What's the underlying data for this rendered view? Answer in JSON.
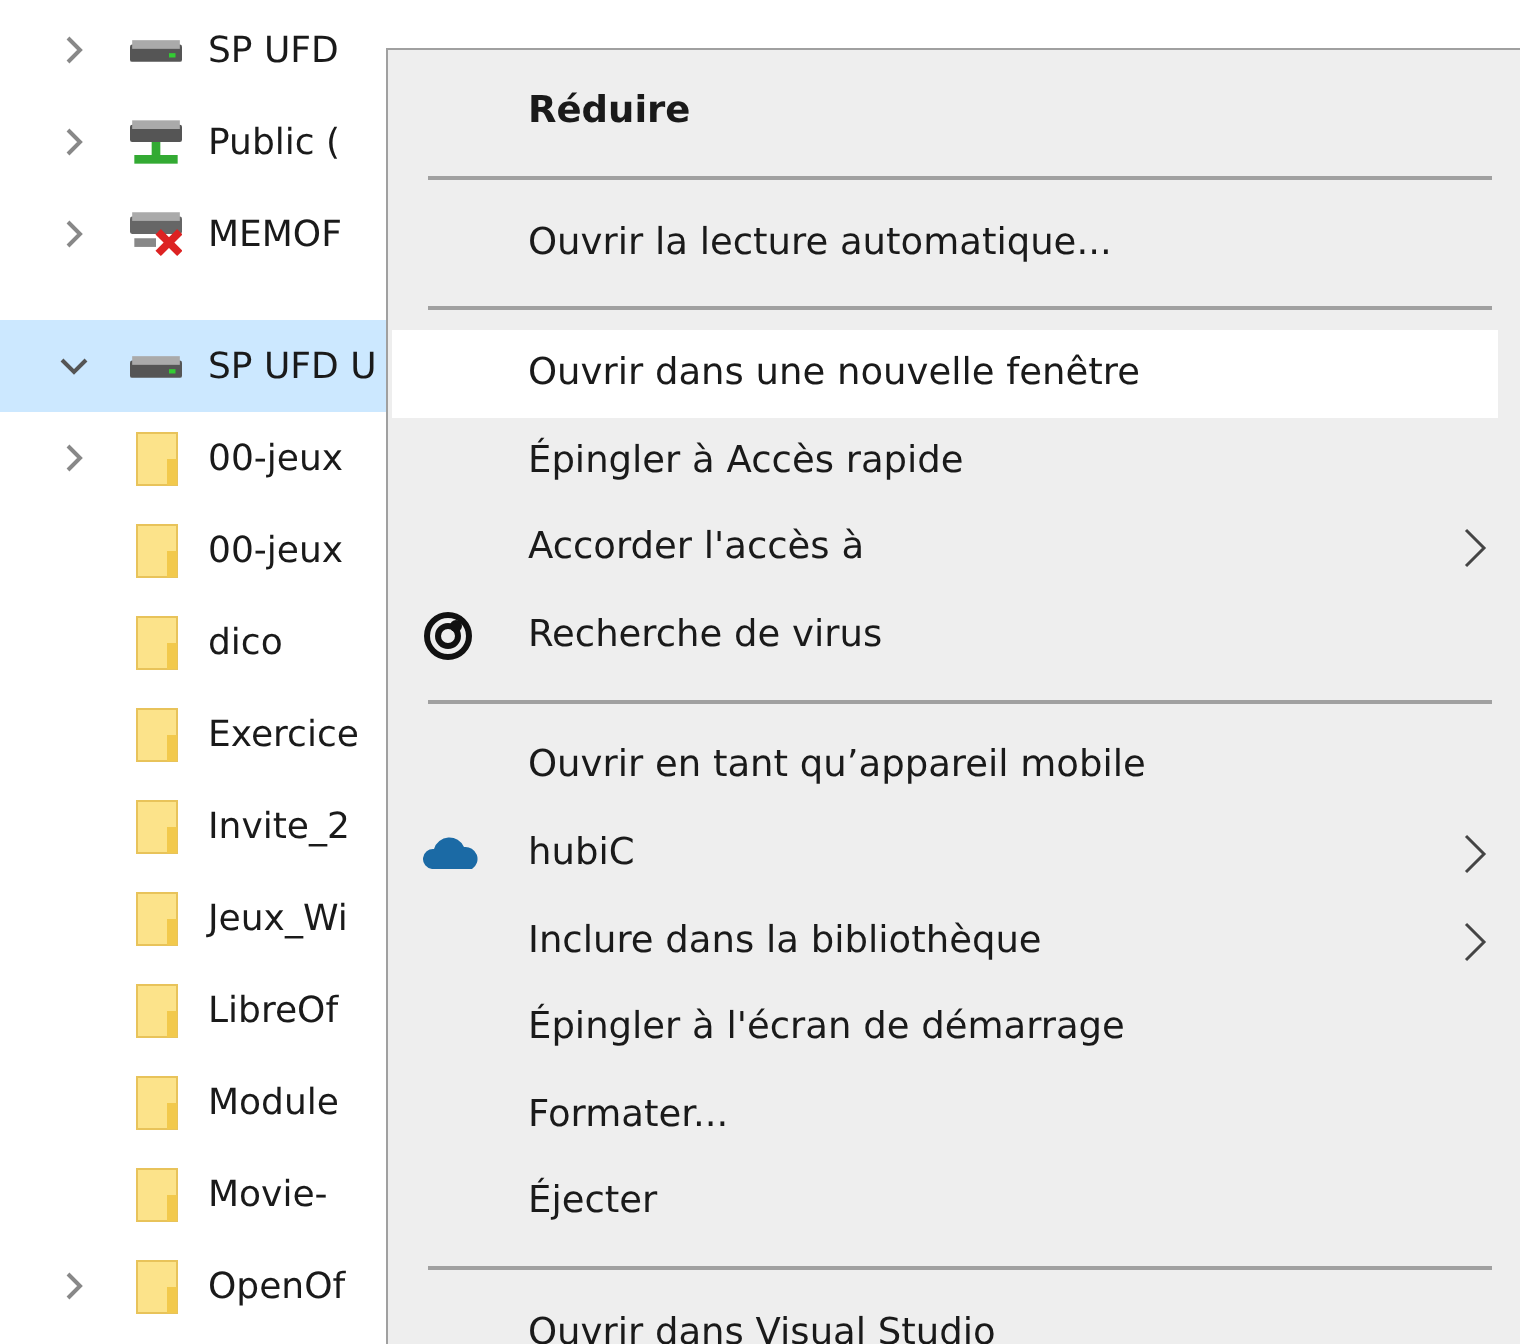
{
  "tree": [
    {
      "label": "SP UFD",
      "kind": "drive",
      "expanded": false,
      "selected": false
    },
    {
      "label": "Public (",
      "kind": "network",
      "expanded": false,
      "selected": false
    },
    {
      "label": "MEMOF",
      "kind": "disconnected",
      "expanded": false,
      "selected": false
    },
    {
      "kind": "spacer"
    },
    {
      "label": "SP UFD U",
      "kind": "drive",
      "expanded": true,
      "selected": true
    },
    {
      "label": "00-jeux",
      "kind": "folder",
      "expanded": false,
      "selected": false
    },
    {
      "label": "00-jeux",
      "kind": "folder",
      "selected": false
    },
    {
      "label": "dico",
      "kind": "folder",
      "selected": false
    },
    {
      "label": "Exercice",
      "kind": "folder",
      "selected": false
    },
    {
      "label": "Invite_2",
      "kind": "folder",
      "selected": false
    },
    {
      "label": "Jeux_Wi",
      "kind": "folder",
      "selected": false
    },
    {
      "label": "LibreOf",
      "kind": "folder",
      "selected": false
    },
    {
      "label": "Module",
      "kind": "folder",
      "selected": false
    },
    {
      "label": "Movie-",
      "kind": "folder",
      "selected": false
    },
    {
      "label": "OpenOf",
      "kind": "folder",
      "expanded": false,
      "selected": false
    }
  ],
  "context_menu": [
    {
      "kind": "plain",
      "label": "Réduire",
      "bold": true,
      "selected": false,
      "submenu": false
    },
    {
      "kind": "separator"
    },
    {
      "kind": "plain",
      "label": "Ouvrir la lecture automatique...",
      "selected": false,
      "submenu": false
    },
    {
      "kind": "separator"
    },
    {
      "kind": "plain",
      "label": "Ouvrir dans une nouvelle fenêtre",
      "selected": true,
      "submenu": false
    },
    {
      "kind": "plain",
      "label": "Épingler à Accès rapide",
      "selected": false,
      "submenu": false
    },
    {
      "kind": "plain",
      "label": "Accorder l'accès à",
      "selected": false,
      "submenu": true
    },
    {
      "kind": "scan",
      "label": "Recherche de virus",
      "selected": false,
      "submenu": false
    },
    {
      "kind": "separator"
    },
    {
      "kind": "plain",
      "label": "Ouvrir en tant qu’appareil mobile",
      "selected": false,
      "submenu": false
    },
    {
      "kind": "cloud",
      "label": "hubiC",
      "selected": false,
      "submenu": true
    },
    {
      "kind": "plain",
      "label": "Inclure dans la bibliothèque",
      "selected": false,
      "submenu": true
    },
    {
      "kind": "plain",
      "label": "Épingler à l'écran de démarrage",
      "selected": false,
      "submenu": false
    },
    {
      "kind": "plain",
      "label": "Formater...",
      "selected": false,
      "submenu": false
    },
    {
      "kind": "plain",
      "label": "Éjecter",
      "selected": false,
      "submenu": false
    },
    {
      "kind": "separator"
    },
    {
      "kind": "plain",
      "label": "Ouvrir dans Visual Studio",
      "selected": false,
      "submenu": false
    }
  ]
}
